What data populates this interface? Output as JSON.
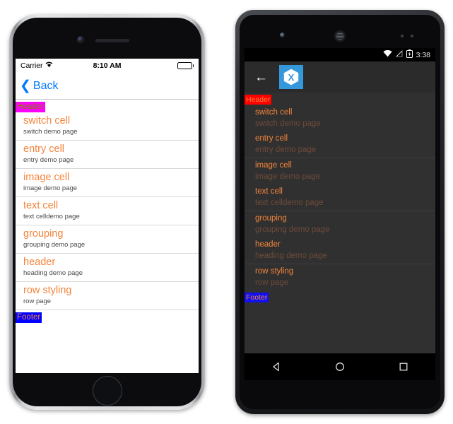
{
  "ios": {
    "status": {
      "carrier": "Carrier",
      "wifi_icon": "wifi-icon",
      "clock": "8:10 AM",
      "battery_icon": "battery-full-icon"
    },
    "nav": {
      "back_icon": "chevron-left-icon",
      "back_label": "Back"
    },
    "list": {
      "header_label": "Header",
      "footer_label": "Footer",
      "rows": [
        {
          "title": "switch cell",
          "detail": "switch demo page"
        },
        {
          "title": "entry cell",
          "detail": "entry demo page"
        },
        {
          "title": "image cell",
          "detail": "image demo page"
        },
        {
          "title": "text cell",
          "detail": "text celldemo page"
        },
        {
          "title": "grouping",
          "detail": "grouping demo page"
        },
        {
          "title": "header",
          "detail": "heading demo page"
        },
        {
          "title": "row styling",
          "detail": "row page"
        }
      ]
    },
    "colors": {
      "accent": "#f4843c",
      "tint": "#007aff",
      "header_bg": "#ff00ff",
      "header_fg": "#808000",
      "footer_bg": "#0000ff",
      "footer_fg": "#f4843c"
    }
  },
  "android": {
    "status": {
      "wifi_icon": "wifi-icon",
      "signal_icon": "signal-off-icon",
      "battery_icon": "battery-charging-icon",
      "clock": "3:38"
    },
    "appbar": {
      "back_icon": "arrow-left-icon",
      "logo_icon": "xamarin-logo-icon"
    },
    "list": {
      "header_label": "Header",
      "footer_label": "Footer",
      "rows": [
        {
          "title": "switch cell",
          "detail": "switch demo page"
        },
        {
          "title": "entry cell",
          "detail": "entry demo page"
        },
        {
          "title": "image cell",
          "detail": "image demo page"
        },
        {
          "title": "text cell",
          "detail": "text celldemo page"
        },
        {
          "title": "grouping",
          "detail": "grouping demo page"
        },
        {
          "title": "header",
          "detail": "heading demo page"
        },
        {
          "title": "row styling",
          "detail": "row page"
        }
      ]
    },
    "navbar": {
      "back_icon": "nav-back-triangle-icon",
      "home_icon": "nav-home-circle-icon",
      "recents_icon": "nav-recents-square-icon"
    },
    "colors": {
      "accent": "#f4843c",
      "detail": "#6e4a3a",
      "header_bg": "#ff0000",
      "footer_bg": "#1111ee",
      "logo_bg": "#3498db"
    }
  }
}
